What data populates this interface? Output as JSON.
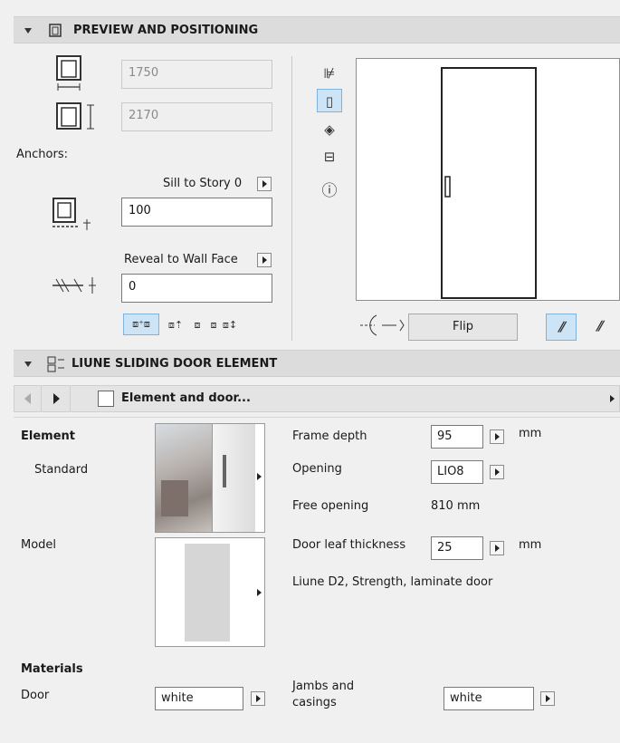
{
  "preview_section": {
    "title": "PREVIEW AND POSITIONING",
    "width_value": "1750",
    "height_value": "2170",
    "anchors_label": "Anchors:",
    "sill_label": "Sill to Story 0",
    "sill_value": "100",
    "reveal_label": "Reveal to Wall Face",
    "reveal_value": "0",
    "flip_label": "Flip"
  },
  "element_section": {
    "title": "LIUNE SLIDING DOOR ELEMENT",
    "nav_title": "Element and door...",
    "element_label": "Element",
    "standard_label": "Standard",
    "model_label": "Model",
    "frame_depth_label": "Frame depth",
    "frame_depth_value": "95",
    "frame_depth_unit": "mm",
    "opening_label": "Opening",
    "opening_value": "LIO8",
    "free_opening_label": "Free opening",
    "free_opening_value": "810 mm",
    "leaf_thickness_label": "Door leaf thickness",
    "leaf_thickness_value": "25",
    "leaf_thickness_unit": "mm",
    "description": "Liune D2, Strength, laminate door",
    "materials_label": "Materials",
    "door_label": "Door",
    "door_value": "white",
    "jambs_label_1": "Jambs and",
    "jambs_label_2": "casings",
    "jambs_value": "white"
  },
  "icons": [
    "window-icon",
    "3d-box-icon",
    "info-icon",
    "flip-icon",
    "door-hinge-icon"
  ],
  "colors": {
    "selected_tool_bg": "#cde4f7",
    "header_bg": "#dcdcdc"
  }
}
